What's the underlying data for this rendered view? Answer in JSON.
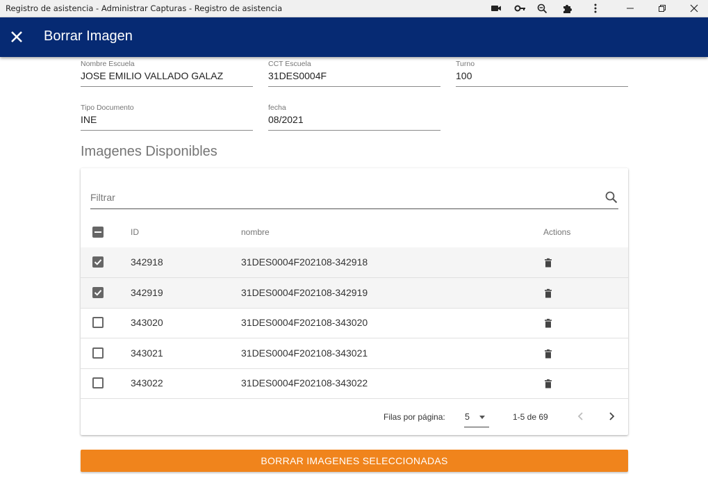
{
  "window": {
    "title": "Registro de asistencia - Administrar Capturas - Registro de asistencia",
    "toolbar_icons": [
      "camera-icon",
      "key-icon",
      "zoom-out-icon",
      "extensions-icon",
      "more-vert-icon"
    ],
    "controls": [
      "minimize-icon",
      "restore-icon",
      "close-window-icon"
    ]
  },
  "appbar": {
    "title": "Borrar Imagen",
    "color": "#062a73"
  },
  "form": {
    "nombre_escuela": {
      "label": "Nombre Escuela",
      "value": "JOSE EMILIO VALLADO GALAZ"
    },
    "cct_escuela": {
      "label": "CCT Escuela",
      "value": "31DES0004F"
    },
    "turno": {
      "label": "Turno",
      "value": "100"
    },
    "tipo_documento": {
      "label": "Tipo Documento",
      "value": "INE"
    },
    "fecha": {
      "label": "fecha",
      "value": "08/2021"
    }
  },
  "images": {
    "section_title": "Imagenes Disponibles",
    "filter_placeholder": "Filtrar",
    "columns": {
      "id": "ID",
      "nombre": "nombre",
      "actions": "Actions"
    },
    "rows": [
      {
        "id": "342918",
        "nombre": "31DES0004F202108-342918",
        "selected": true
      },
      {
        "id": "342919",
        "nombre": "31DES0004F202108-342919",
        "selected": true
      },
      {
        "id": "343020",
        "nombre": "31DES0004F202108-343020",
        "selected": false
      },
      {
        "id": "343021",
        "nombre": "31DES0004F202108-343021",
        "selected": false
      },
      {
        "id": "343022",
        "nombre": "31DES0004F202108-343022",
        "selected": false
      }
    ],
    "pagination": {
      "rows_per_page_label": "Filas por página:",
      "rows_per_page": "5",
      "range": "1-5 de 69"
    }
  },
  "action_button": {
    "label": "BORRAR IMAGENES SELECCIONADAS",
    "color": "#f0841c"
  }
}
